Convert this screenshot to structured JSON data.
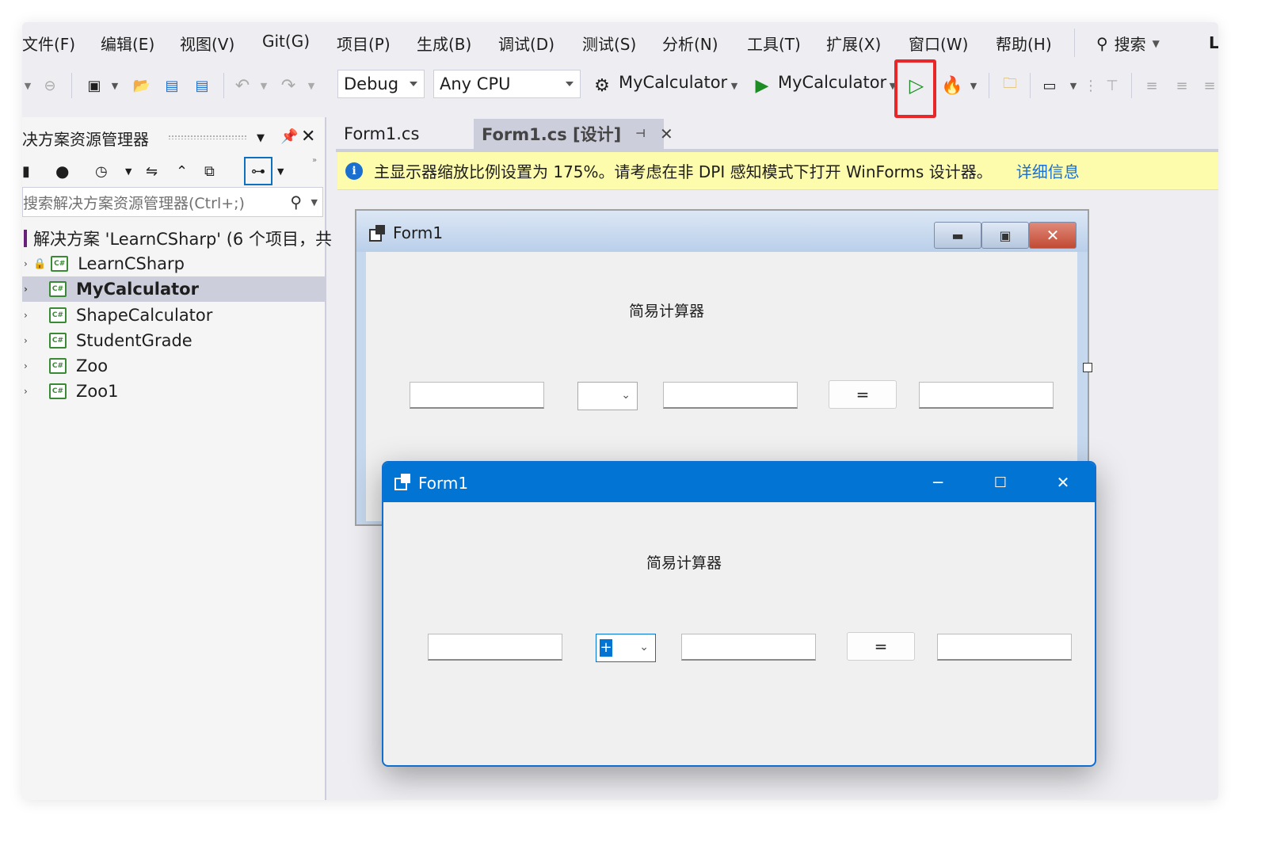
{
  "menu": {
    "items": [
      "文件(F)",
      "编辑(E)",
      "视图(V)",
      "Git(G)",
      "项目(P)",
      "生成(B)",
      "调试(D)",
      "测试(S)",
      "分析(N)",
      "工具(T)",
      "扩展(X)",
      "窗口(W)",
      "帮助(H)"
    ],
    "search_label": "搜索",
    "user_initial": "L"
  },
  "toolbar": {
    "config": "Debug",
    "platform": "Any CPU",
    "startup_project": "MyCalculator",
    "start_target": "MyCalculator",
    "highlight_color": "#e8272a"
  },
  "solution_explorer": {
    "title": "决方案资源管理器",
    "search_placeholder": "搜索解决方案资源管理器(Ctrl+;)",
    "solution_label": "解决方案 'LearnCSharp' (6 个项目，共",
    "projects": [
      "LearnCSharp",
      "MyCalculator",
      "ShapeCalculator",
      "StudentGrade",
      "Zoo",
      "Zoo1"
    ],
    "selected": "MyCalculator"
  },
  "tabs": [
    "Form1.cs",
    "Form1.cs [设计]"
  ],
  "infobar": {
    "message": "主显示器缩放比例设置为 175%。请考虑在非 DPI 感知模式下打开 WinForms 设计器。",
    "link": "详细信息"
  },
  "designer_form": {
    "title": "Form1",
    "label": "简易计算器",
    "equals": "=",
    "operator": ""
  },
  "running_form": {
    "title": "Form1",
    "label": "简易计算器",
    "equals": "=",
    "operator": "+",
    "accent": "#0174d4"
  }
}
